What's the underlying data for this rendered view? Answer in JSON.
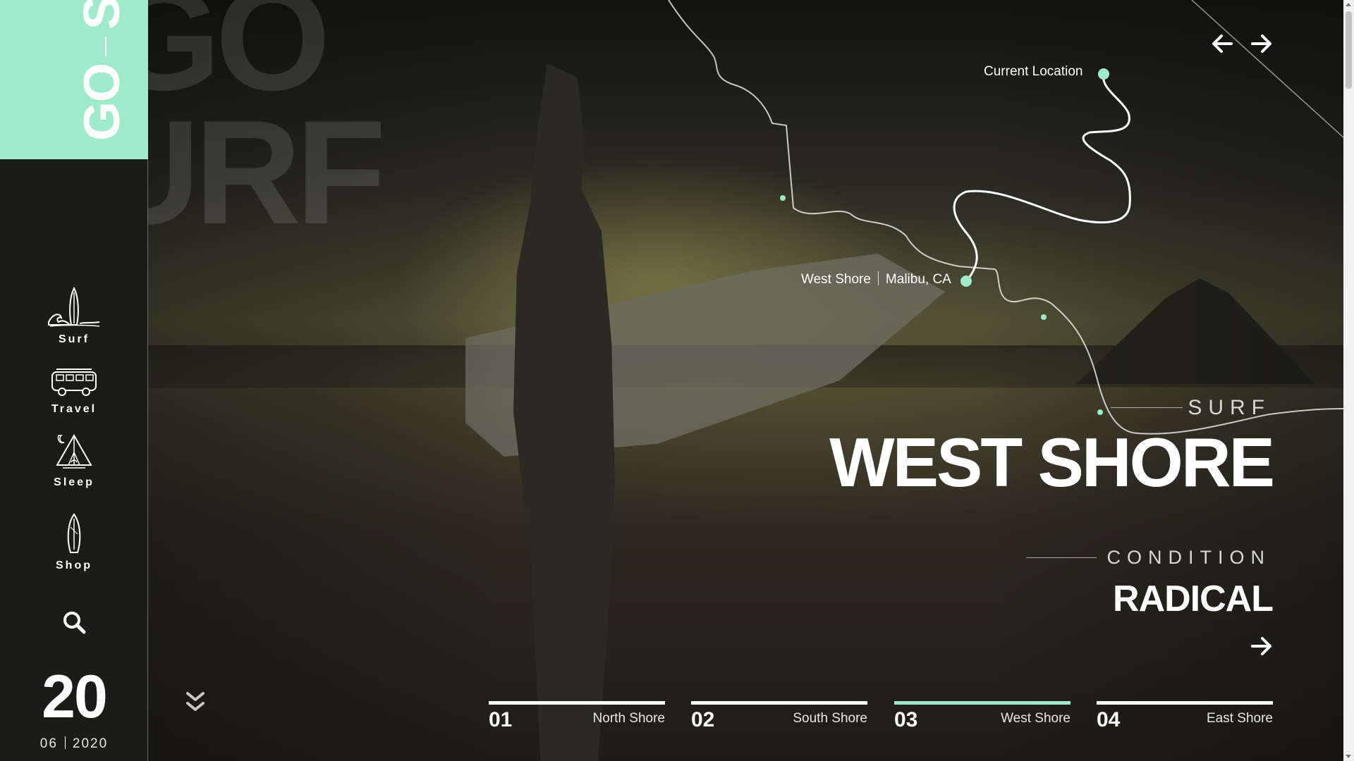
{
  "brand": {
    "go": "GO",
    "surf": "SURF",
    "ghost_line1": "GO",
    "ghost_line2": "SURF",
    "accent_color": "#9eeac9"
  },
  "sidebar": {
    "items": [
      {
        "label": "Surf",
        "icon": "surfboard-wave-icon"
      },
      {
        "label": "Travel",
        "icon": "van-icon"
      },
      {
        "label": "Sleep",
        "icon": "tent-icon"
      },
      {
        "label": "Shop",
        "icon": "surfboard-icon"
      }
    ],
    "search_icon": "search-icon",
    "date": {
      "day": "20",
      "month": "06",
      "year": "2020"
    }
  },
  "map": {
    "current_location_label": "Current Location",
    "destination_label": "West Shore",
    "destination_region": "Malibu, CA"
  },
  "hero": {
    "tag": "SURF",
    "title": "WEST SHORE",
    "condition_tag": "CONDITION",
    "condition_value": "RADICAL"
  },
  "tabs": [
    {
      "num": "01",
      "name": "North Shore",
      "active": false
    },
    {
      "num": "02",
      "name": "South Shore",
      "active": false
    },
    {
      "num": "03",
      "name": "West Shore",
      "active": true
    },
    {
      "num": "04",
      "name": "East Shore",
      "active": false
    }
  ]
}
